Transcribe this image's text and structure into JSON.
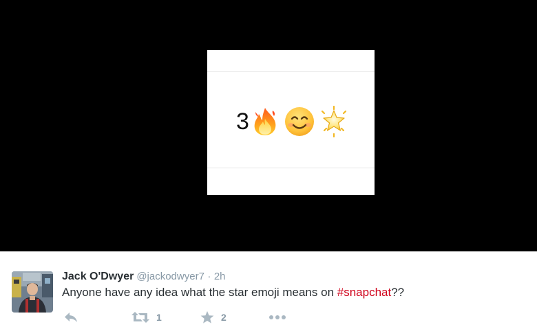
{
  "media": {
    "streak_number": "3",
    "emoji_icons": [
      "fire-icon",
      "smiling-face-icon",
      "glowing-star-icon"
    ],
    "background_color": "#000000"
  },
  "tweet": {
    "author_name": "Jack O'Dwyer",
    "author_handle": "@jackodwyer7",
    "separator": "·",
    "timestamp": "2h",
    "text_before": "Anyone have any idea what the star emoji means on ",
    "hashtag": "#snapchat",
    "text_after": "??",
    "hashtag_color": "#d0021b",
    "actions": {
      "reply_icon": "reply-icon",
      "retweet_icon": "retweet-icon",
      "retweet_count": "1",
      "favorite_icon": "star-icon",
      "favorite_count": "2",
      "more_icon": "more-icon"
    }
  }
}
